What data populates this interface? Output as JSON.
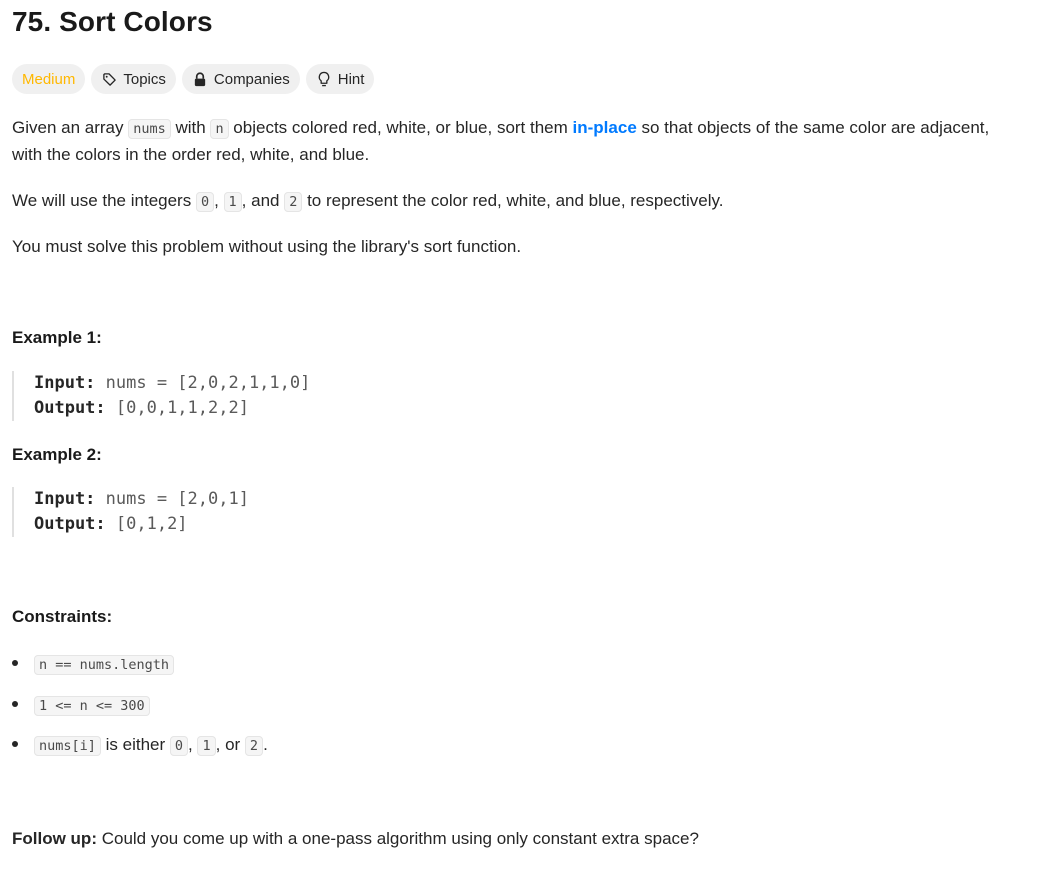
{
  "problem": {
    "title": "75. Sort Colors",
    "difficulty": "Medium",
    "chips": {
      "topics": "Topics",
      "companies": "Companies",
      "hint": "Hint"
    }
  },
  "description": {
    "p1": {
      "t1": "Given an array ",
      "c1": "nums",
      "t2": " with ",
      "c2": "n",
      "t3": " objects colored red, white, or blue, sort them ",
      "link": "in-place",
      "t4": " so that objects of the same color are adjacent, with the colors in the order red, white, and blue."
    },
    "p2": {
      "t1": "We will use the integers ",
      "c1": "0",
      "t2": ", ",
      "c2": "1",
      "t3": ", and ",
      "c3": "2",
      "t4": " to represent the color red, white, and blue, respectively."
    },
    "p3": "You must solve this problem without using the library's sort function."
  },
  "examples": [
    {
      "heading": "Example 1:",
      "input_label": "Input:",
      "input_value": " nums = [2,0,2,1,1,0]",
      "output_label": "Output:",
      "output_value": " [0,0,1,1,2,2]"
    },
    {
      "heading": "Example 2:",
      "input_label": "Input:",
      "input_value": " nums = [2,0,1]",
      "output_label": "Output:",
      "output_value": " [0,1,2]"
    }
  ],
  "constraints": {
    "heading": "Constraints:",
    "items": [
      {
        "code": "n == nums.length"
      },
      {
        "code": "1 <= n <= 300"
      },
      {
        "c1": "nums[i]",
        "t1": " is either ",
        "c2": "0",
        "t2": ", ",
        "c3": "1",
        "t3": ", or ",
        "c4": "2",
        "t4": "."
      }
    ]
  },
  "follow_up": {
    "label": "Follow up:",
    "text": " Could you come up with a one-pass algorithm using only constant extra space?"
  },
  "colors": {
    "medium": "#ffb800",
    "link": "#007aff",
    "chip_bg": "#f0f0f0"
  },
  "icons": {
    "topics": "tag-icon",
    "companies": "lock-icon",
    "hint": "lightbulb-icon"
  }
}
